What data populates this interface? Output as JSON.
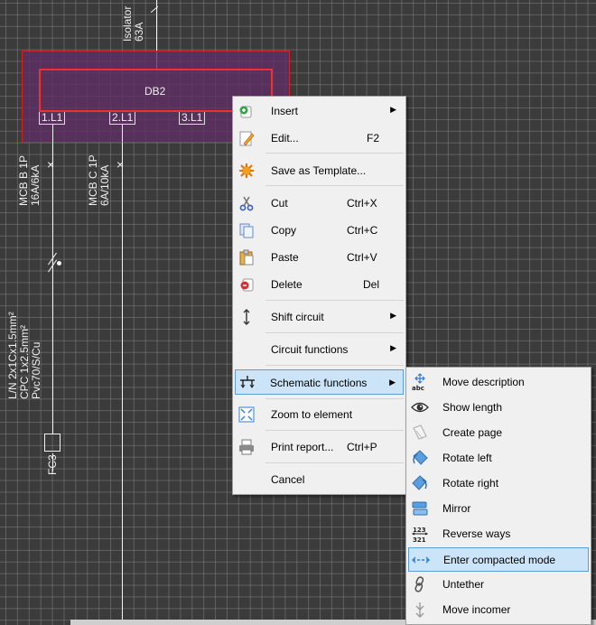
{
  "canvas": {
    "isolator": {
      "label": "Isolator",
      "rating": "63A"
    },
    "board": {
      "name": "DB2",
      "ways": [
        "1.L1",
        "2.L1",
        "3.L1"
      ]
    },
    "mcb_b": {
      "name": "MCB B 1P",
      "rating": "16A/6kA"
    },
    "mcb_c": {
      "name": "MCB C 1P",
      "rating": "6A/10kA"
    },
    "cable": {
      "line1": "L/N 2x1Cx1.5mm²",
      "line2": "CPC  1x2.5mm²",
      "line3": "Pvc70/S/Cu"
    },
    "fc_label": "FC3"
  },
  "context_menu": {
    "items": [
      {
        "label": "Insert",
        "shortcut": "",
        "submenu": true,
        "icon": "insert-icon"
      },
      {
        "label": "Edit...",
        "shortcut": "F2",
        "submenu": false,
        "icon": "edit-icon"
      },
      {
        "label": "Save as Template...",
        "shortcut": "",
        "submenu": false,
        "icon": "save-template-icon"
      },
      {
        "label": "Cut",
        "shortcut": "Ctrl+X",
        "submenu": false,
        "icon": "scissors-icon"
      },
      {
        "label": "Copy",
        "shortcut": "Ctrl+C",
        "submenu": false,
        "icon": "copy-icon"
      },
      {
        "label": "Paste",
        "shortcut": "Ctrl+V",
        "submenu": false,
        "icon": "paste-icon"
      },
      {
        "label": "Delete",
        "shortcut": "Del",
        "submenu": false,
        "icon": "delete-icon"
      },
      {
        "label": "Shift circuit",
        "shortcut": "",
        "submenu": true,
        "icon": "shift-icon"
      },
      {
        "label": "Circuit functions",
        "shortcut": "",
        "submenu": true,
        "icon": ""
      },
      {
        "label": "Schematic functions",
        "shortcut": "",
        "submenu": true,
        "icon": "schematic-icon"
      },
      {
        "label": "Zoom to element",
        "shortcut": "",
        "submenu": false,
        "icon": "zoom-icon"
      },
      {
        "label": "Print report...",
        "shortcut": "Ctrl+P",
        "submenu": false,
        "icon": "printer-icon"
      },
      {
        "label": "Cancel",
        "shortcut": "",
        "submenu": false,
        "icon": ""
      }
    ]
  },
  "sub_menu": {
    "items": [
      {
        "label": "Move description",
        "icon": "move-description-icon"
      },
      {
        "label": "Show length",
        "icon": "eye-icon"
      },
      {
        "label": "Create page",
        "icon": "create-page-icon"
      },
      {
        "label": "Rotate left",
        "icon": "rotate-left-icon"
      },
      {
        "label": "Rotate right",
        "icon": "rotate-right-icon"
      },
      {
        "label": "Mirror",
        "icon": "mirror-icon"
      },
      {
        "label": "Reverse ways",
        "icon": "reverse-ways-icon"
      },
      {
        "label": "Enter compacted mode",
        "icon": "compact-icon"
      },
      {
        "label": "Untether",
        "icon": "untether-icon"
      },
      {
        "label": "Move incomer",
        "icon": "move-incomer-icon"
      }
    ]
  },
  "colors": {
    "highlight": "#cce4f7",
    "board_fill": "#5a3a5e",
    "board_border": "#e02020",
    "accent": "#2f7fd6"
  }
}
